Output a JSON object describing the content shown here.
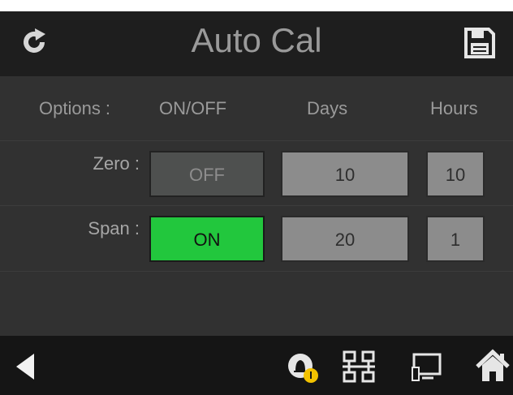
{
  "header": {
    "title": "Auto Cal",
    "refresh_icon": "refresh-icon",
    "save_icon": "floppy-disk-icon"
  },
  "columns": {
    "options_label": "Options :",
    "onoff_label": "ON/OFF",
    "days_label": "Days",
    "hours_label": "Hours"
  },
  "rows": [
    {
      "label": "Zero :",
      "toggle": "OFF",
      "days": "10",
      "hours": "10"
    },
    {
      "label": "Span :",
      "toggle": "ON",
      "days": "20",
      "hours": "1"
    }
  ],
  "footer": {
    "back_icon": "back-arrow-icon",
    "alarm_icon": "alarm-bell-icon",
    "network_icon": "network-icon",
    "monitor_icon": "monitor-icon",
    "home_icon": "home-icon"
  },
  "colors": {
    "background": "#313131",
    "header_bg": "#1e1e1e",
    "footer_bg": "#151515",
    "on_green": "#22c73d",
    "off_gray": "#4e504f",
    "value_gray": "#8c8c8c",
    "alarm_badge": "#f2c200"
  }
}
